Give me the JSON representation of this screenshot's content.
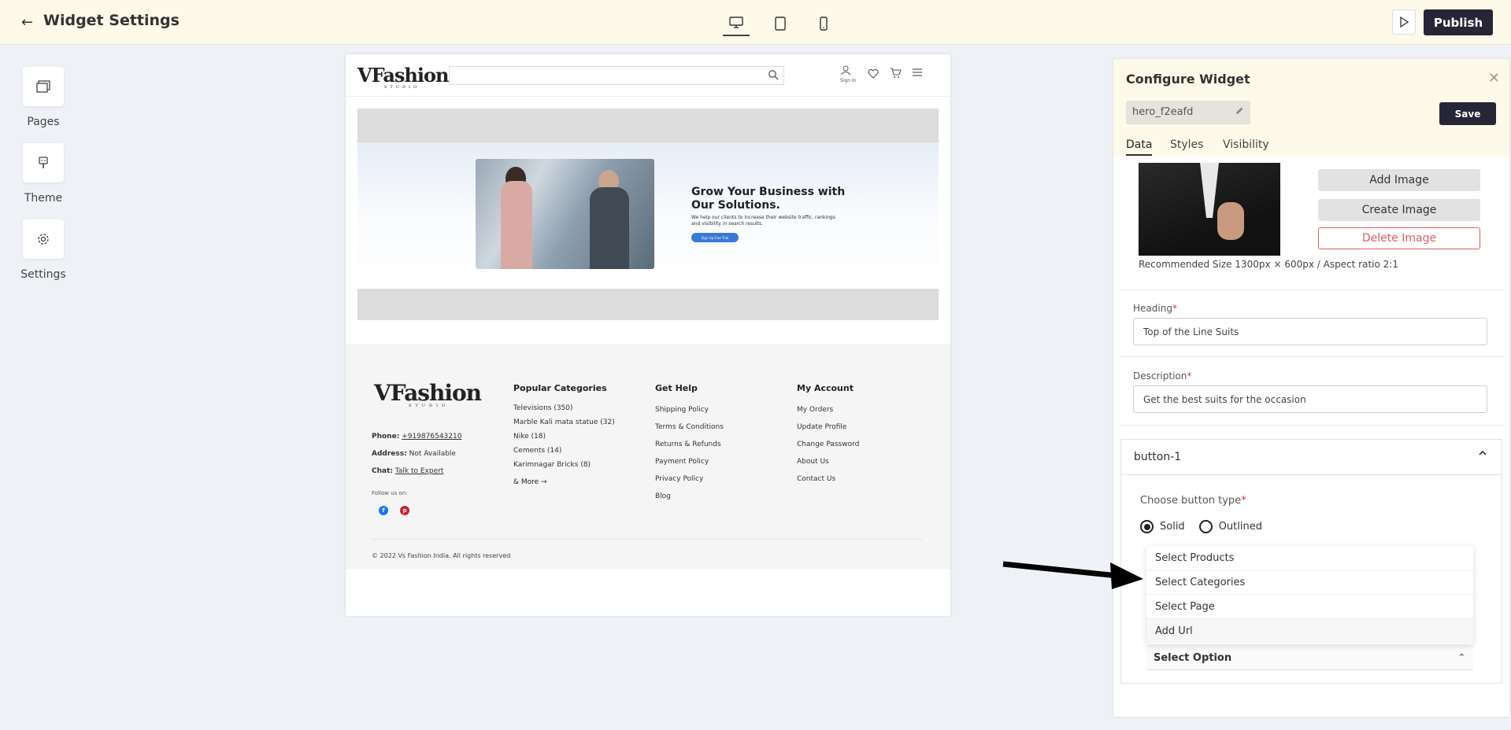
{
  "topbar": {
    "back_icon": "arrow-left-icon",
    "title": "Widget Settings",
    "devices": [
      "desktop-icon",
      "tablet-icon",
      "mobile-icon"
    ],
    "preview_icon": "play-icon",
    "publish_label": "Publish"
  },
  "rail": {
    "items": [
      {
        "label": "Pages",
        "icon": "pages-icon"
      },
      {
        "label": "Theme",
        "icon": "theme-icon"
      },
      {
        "label": "Settings",
        "icon": "gear-icon"
      }
    ]
  },
  "preview": {
    "logo": {
      "main": "VFashion",
      "sub": "STUDIO"
    },
    "signin_label": "Sign In",
    "hero": {
      "title": "Grow Your Business with Our Solutions.",
      "description": "We help our clients to increase their website traffic, rankings and visibility in search results.",
      "cta": "Sign Up Free Trial"
    },
    "footer": {
      "phone_label": "Phone:",
      "phone": "+919876543210",
      "address_label": "Address:",
      "address": "Not Available",
      "chat_label": "Chat:",
      "chat": "Talk to Expert",
      "follow": "Follow us on:",
      "columns": [
        {
          "title": "Popular Categories",
          "items": [
            "Televisions (350)",
            "Marble Kali mata statue (32)",
            "Nike (18)",
            "Cements (14)",
            "Karimnagar Bricks (8)"
          ],
          "more": "& More →"
        },
        {
          "title": "Get Help",
          "items": [
            "Shipping Policy",
            "Terms & Conditions",
            "Returns & Refunds",
            "Payment Policy",
            "Privacy Policy",
            "Blog"
          ]
        },
        {
          "title": "My Account",
          "items": [
            "My Orders",
            "Update Profile",
            "Change Password",
            "About Us",
            "Contact Us"
          ]
        }
      ],
      "copyright": "© 2022 Vs Fashion India. All rights reserved"
    }
  },
  "panel": {
    "title": "Configure Widget",
    "widget_id": "hero_f2eafd",
    "save_label": "Save",
    "tabs": [
      "Data",
      "Styles",
      "Visibility"
    ],
    "image_actions": [
      "Add Image",
      "Create Image",
      "Delete Image"
    ],
    "recommended": "Recommended Size 1300px × 600px / Aspect ratio 2:1",
    "heading_label": "Heading",
    "heading_value": "Top of the Line Suits",
    "description_label": "Description",
    "description_value": "Get the best suits for the occasion",
    "button_section": "button-1",
    "button_type_label": "Choose button type",
    "button_types": [
      "Solid",
      "Outlined"
    ],
    "dropdown_options": [
      "Select Products",
      "Select Categories",
      "Select Page",
      "Add Url"
    ],
    "select_placeholder": "Select Option",
    "required_mark": "*"
  },
  "colors": {
    "accent": "#262636",
    "topbar": "#fdfaea",
    "danger": "#e05d5d",
    "hero_button": "#3a78d6"
  }
}
